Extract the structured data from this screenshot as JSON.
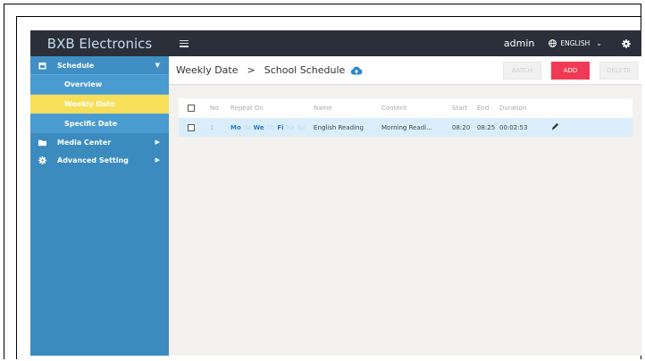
{
  "brand": "BXB Electronics",
  "sidebar": {
    "items": [
      {
        "label": "Schedule",
        "icon": "calendar-icon"
      },
      {
        "label": "Overview"
      },
      {
        "label": "Weekly Date"
      },
      {
        "label": "Specific Date"
      },
      {
        "label": "Media Center",
        "icon": "folder-icon"
      },
      {
        "label": "Advanced Setting",
        "icon": "gear-icon"
      }
    ]
  },
  "topbar": {
    "user": "admin",
    "language": "ENGLISH"
  },
  "breadcrumb": {
    "root": "Weekly Date",
    "separator": ">",
    "current": "School Schedule"
  },
  "buttons": {
    "batch": "BATCH",
    "add": "ADD",
    "delete": "DELETE"
  },
  "table": {
    "headers": [
      "No",
      "Repeat On",
      "Name",
      "Content",
      "Start",
      "End",
      "Duration"
    ],
    "rows": [
      {
        "no": "1",
        "days": [
          "Mo",
          "Tu",
          "We",
          "Th",
          "Fi",
          "Sa",
          "Su"
        ],
        "active_days": [
          "Mo",
          "We",
          "Fi"
        ],
        "name": "English Reading",
        "content": "Morning Readi...",
        "start": "08:20",
        "end": "08:25",
        "duration": "00:02:53"
      }
    ]
  },
  "colors": {
    "sidebar": "#3b8bbf",
    "active_item": "#f7df59",
    "topbar": "#2a2f3a",
    "add_button": "#f03a55",
    "selected_row": "#d9eefa"
  }
}
